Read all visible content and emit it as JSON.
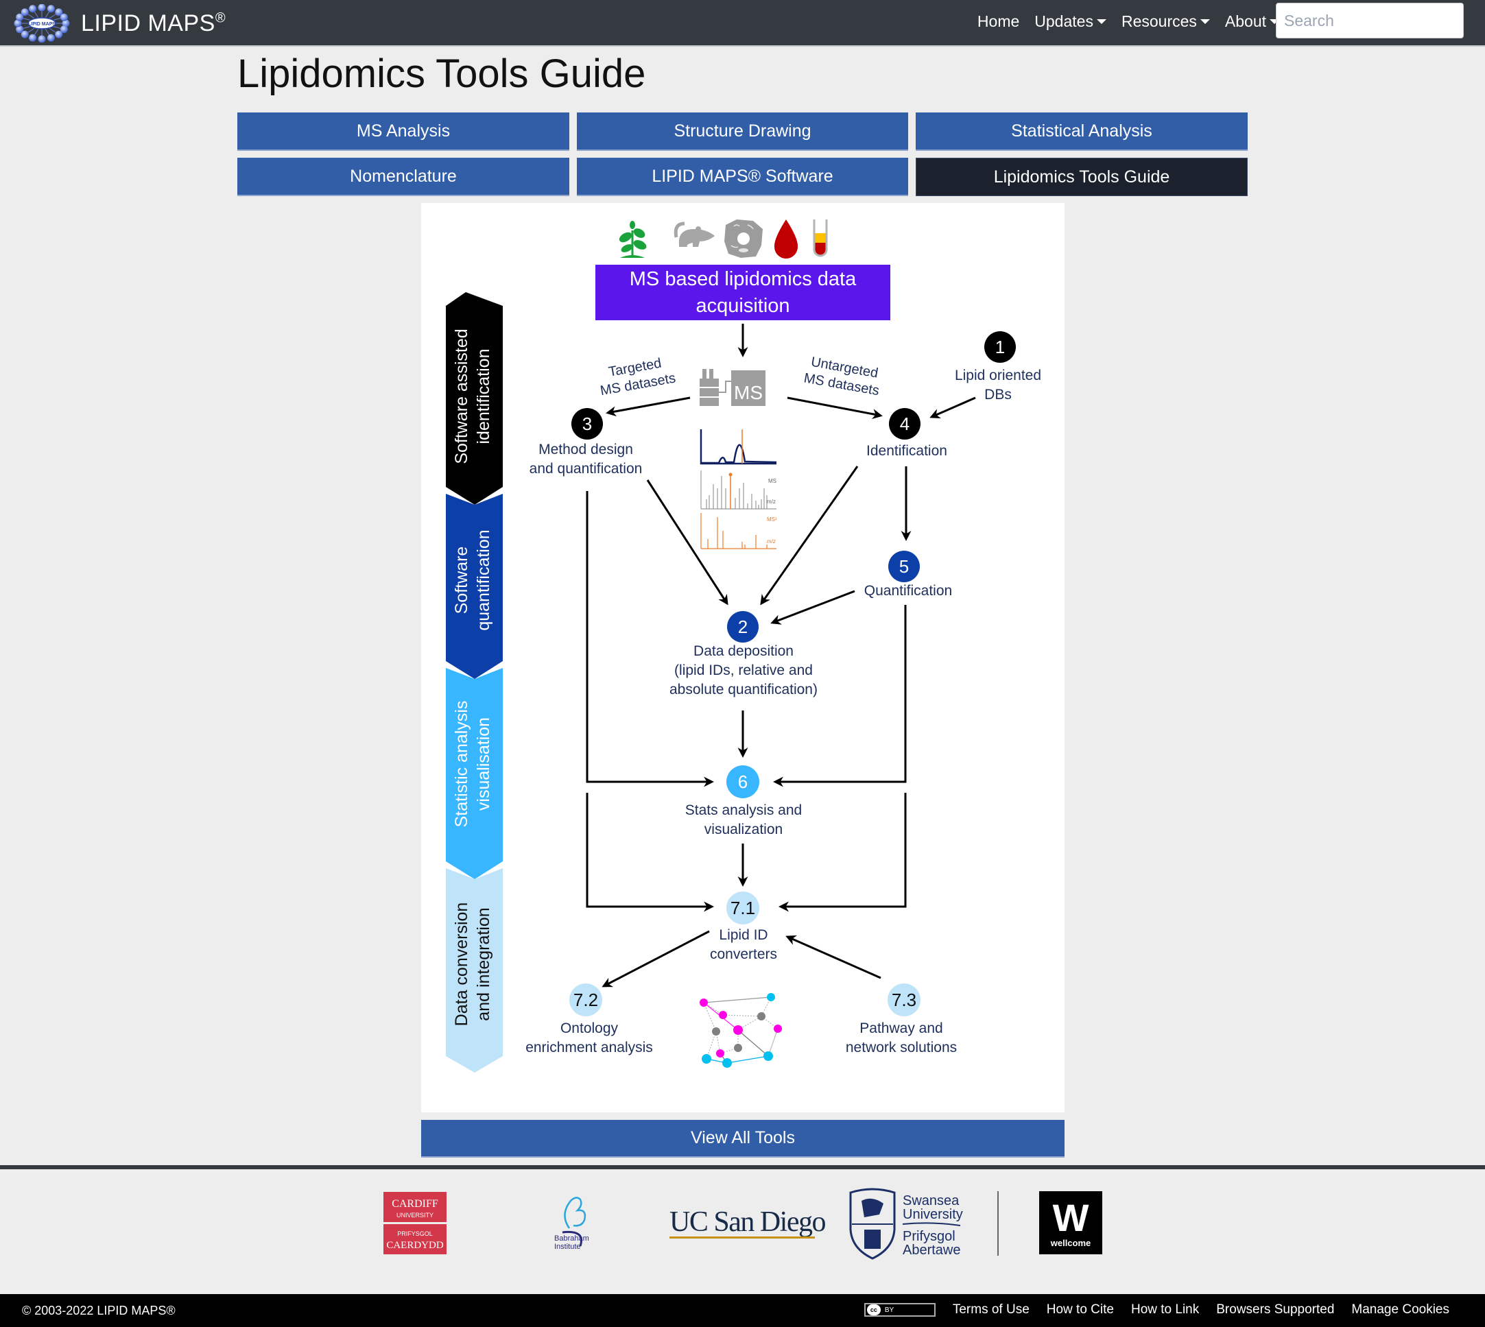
{
  "navbar": {
    "brand": "LIPID MAPS",
    "brand_mark": "®",
    "logo_text": "LIPID MAPS",
    "links": [
      {
        "label": "Home",
        "dropdown": false
      },
      {
        "label": "Updates",
        "dropdown": true
      },
      {
        "label": "Resources",
        "dropdown": true
      },
      {
        "label": "About",
        "dropdown": true
      }
    ],
    "search_placeholder": "Search",
    "search_value": ""
  },
  "page": {
    "title": "Lipidomics Tools Guide"
  },
  "tiles": [
    {
      "label": "MS Analysis",
      "active": false
    },
    {
      "label": "Structure Drawing",
      "active": false
    },
    {
      "label": "Statistical Analysis",
      "active": false
    },
    {
      "label": "Nomenclature",
      "active": false
    },
    {
      "label": "LIPID MAPS® Software",
      "active": false
    },
    {
      "label": "Lipidomics Tools Guide",
      "active": true
    }
  ],
  "diagram": {
    "sample_icons": [
      "plant-icon",
      "mouse-icon",
      "cell-icon",
      "blood-drop-icon",
      "test-tube-icon"
    ],
    "acquisition_box": {
      "line1": "MS based lipidomics data",
      "line2": "acquisition",
      "color": "#5b17eb"
    },
    "ms_instrument_label": "MS",
    "spectra_labels": {
      "ms": "MS",
      "ms2": "MS²",
      "mz": "m/z"
    },
    "side_stages": [
      {
        "line1": "Software assisted",
        "line2": "identification",
        "color": "#000000"
      },
      {
        "line1": "Software",
        "line2": "quantification",
        "color": "#0c3fa8"
      },
      {
        "line1": "Statistic analysis",
        "line2": "visualisation",
        "color": "#38b6ff"
      },
      {
        "line1": "Data conversion",
        "line2": "and integration",
        "color": "#bfe3f9"
      }
    ],
    "edge_labels": {
      "targeted": {
        "line1": "Targeted",
        "line2": "MS datasets"
      },
      "untargeted": {
        "line1": "Untargeted",
        "line2": "MS datasets"
      }
    },
    "nodes": [
      {
        "id": "1",
        "label_lines": [
          "Lipid oriented",
          "DBs"
        ],
        "color": "#000000"
      },
      {
        "id": "3",
        "label_lines": [
          "Method design",
          "and quantification"
        ],
        "color": "#000000"
      },
      {
        "id": "4",
        "label_lines": [
          "Identification"
        ],
        "color": "#000000"
      },
      {
        "id": "5",
        "label_lines": [
          "Quantification"
        ],
        "color": "#0c3fa8"
      },
      {
        "id": "2",
        "label_lines": [
          "Data deposition",
          "(lipid IDs, relative and",
          "absolute quantification)"
        ],
        "color": "#0c3fa8"
      },
      {
        "id": "6",
        "label_lines": [
          "Stats analysis and",
          "visualization"
        ],
        "color": "#38b6ff"
      },
      {
        "id": "7.1",
        "label_lines": [
          "Lipid ID",
          "converters"
        ],
        "color": "#bfe3f9"
      },
      {
        "id": "7.2",
        "label_lines": [
          "Ontology",
          "enrichment analysis"
        ],
        "color": "#bfe3f9"
      },
      {
        "id": "7.3",
        "label_lines": [
          "Pathway and",
          "network solutions"
        ],
        "color": "#bfe3f9"
      }
    ]
  },
  "view_all_button": "View All Tools",
  "partners": [
    "Cardiff University",
    "Babraham Institute",
    "UC San Diego",
    "Swansea University",
    "Wellcome"
  ],
  "partner_text": {
    "cardiff": {
      "l1": "CARDIFF",
      "l2": "UNIVERSITY",
      "l3": "PRIFYSGOL",
      "l4": "CAERDYDD"
    },
    "babraham": {
      "l1": "Babraham",
      "l2": "Institute"
    },
    "ucsd": "UC San Diego",
    "swansea": {
      "l1": "Swansea",
      "l2": "University",
      "l3": "Prifysgol",
      "l4": "Abertawe"
    },
    "wellcome": {
      "mark": "W",
      "name": "wellcome"
    }
  },
  "footer": {
    "copyright": "© 2003-2022 LIPID MAPS®",
    "license_badge": {
      "cc": "cc",
      "by": "BY"
    },
    "links": [
      "Terms of Use",
      "How to Cite",
      "How to Link",
      "Browsers Supported",
      "Manage Cookies"
    ]
  }
}
